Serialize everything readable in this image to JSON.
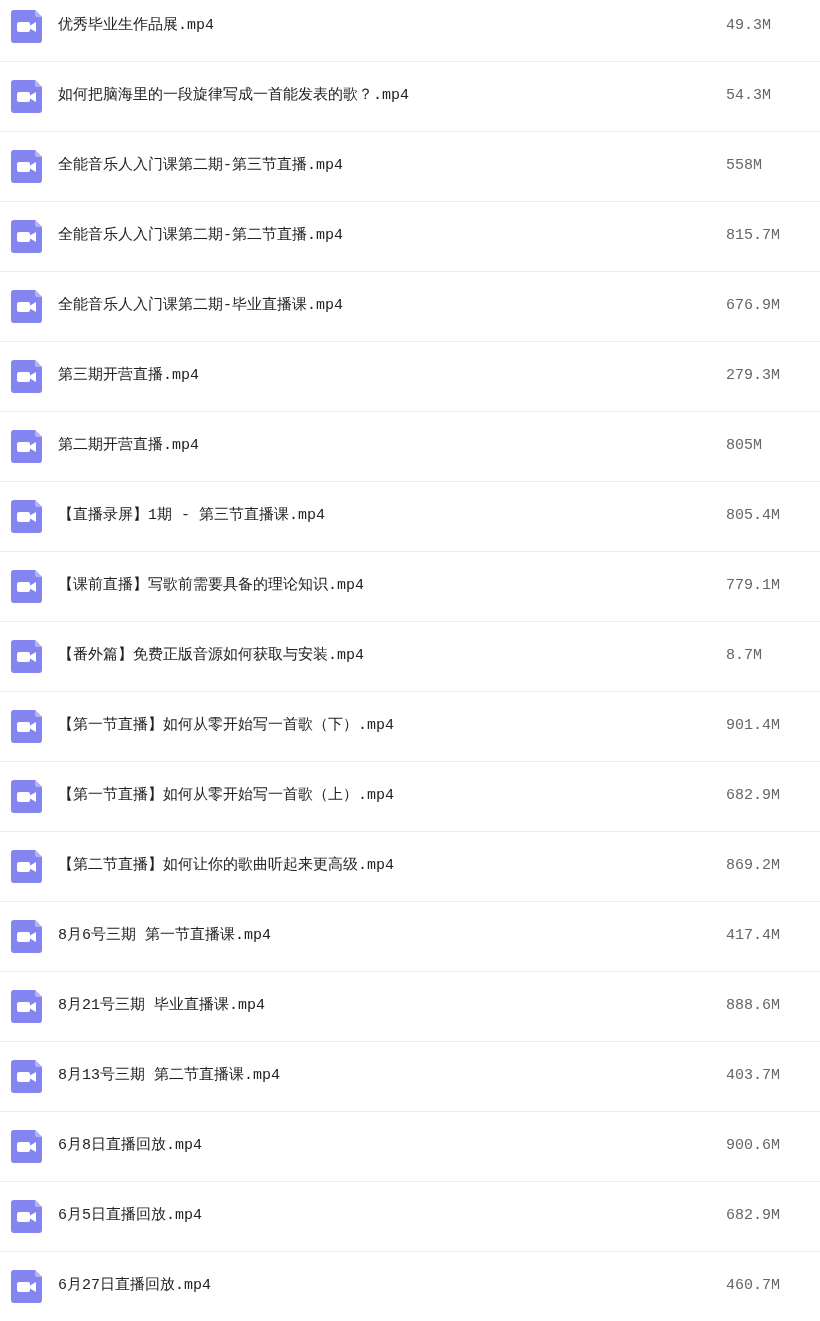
{
  "files": [
    {
      "name": "优秀毕业生作品展.mp4",
      "size": "49.3M"
    },
    {
      "name": "如何把脑海里的一段旋律写成一首能发表的歌？.mp4",
      "size": "54.3M"
    },
    {
      "name": "全能音乐人入门课第二期-第三节直播.mp4",
      "size": "558M"
    },
    {
      "name": "全能音乐人入门课第二期-第二节直播.mp4",
      "size": "815.7M"
    },
    {
      "name": "全能音乐人入门课第二期-毕业直播课.mp4",
      "size": "676.9M"
    },
    {
      "name": "第三期开营直播.mp4",
      "size": "279.3M"
    },
    {
      "name": "第二期开营直播.mp4",
      "size": "805M"
    },
    {
      "name": "【直播录屏】1期 - 第三节直播课.mp4",
      "size": "805.4M"
    },
    {
      "name": "【课前直播】写歌前需要具备的理论知识.mp4",
      "size": "779.1M"
    },
    {
      "name": "【番外篇】免费正版音源如何获取与安装.mp4",
      "size": "8.7M"
    },
    {
      "name": "【第一节直播】如何从零开始写一首歌（下）.mp4",
      "size": "901.4M"
    },
    {
      "name": "【第一节直播】如何从零开始写一首歌（上）.mp4",
      "size": "682.9M"
    },
    {
      "name": "【第二节直播】如何让你的歌曲听起来更高级.mp4",
      "size": "869.2M"
    },
    {
      "name": "8月6号三期 第一节直播课.mp4",
      "size": "417.4M"
    },
    {
      "name": "8月21号三期 毕业直播课.mp4",
      "size": "888.6M"
    },
    {
      "name": "8月13号三期 第二节直播课.mp4",
      "size": "403.7M"
    },
    {
      "name": "6月8日直播回放.mp4",
      "size": "900.6M"
    },
    {
      "name": "6月5日直播回放.mp4",
      "size": "682.9M"
    },
    {
      "name": "6月27日直播回放.mp4",
      "size": "460.7M"
    }
  ]
}
